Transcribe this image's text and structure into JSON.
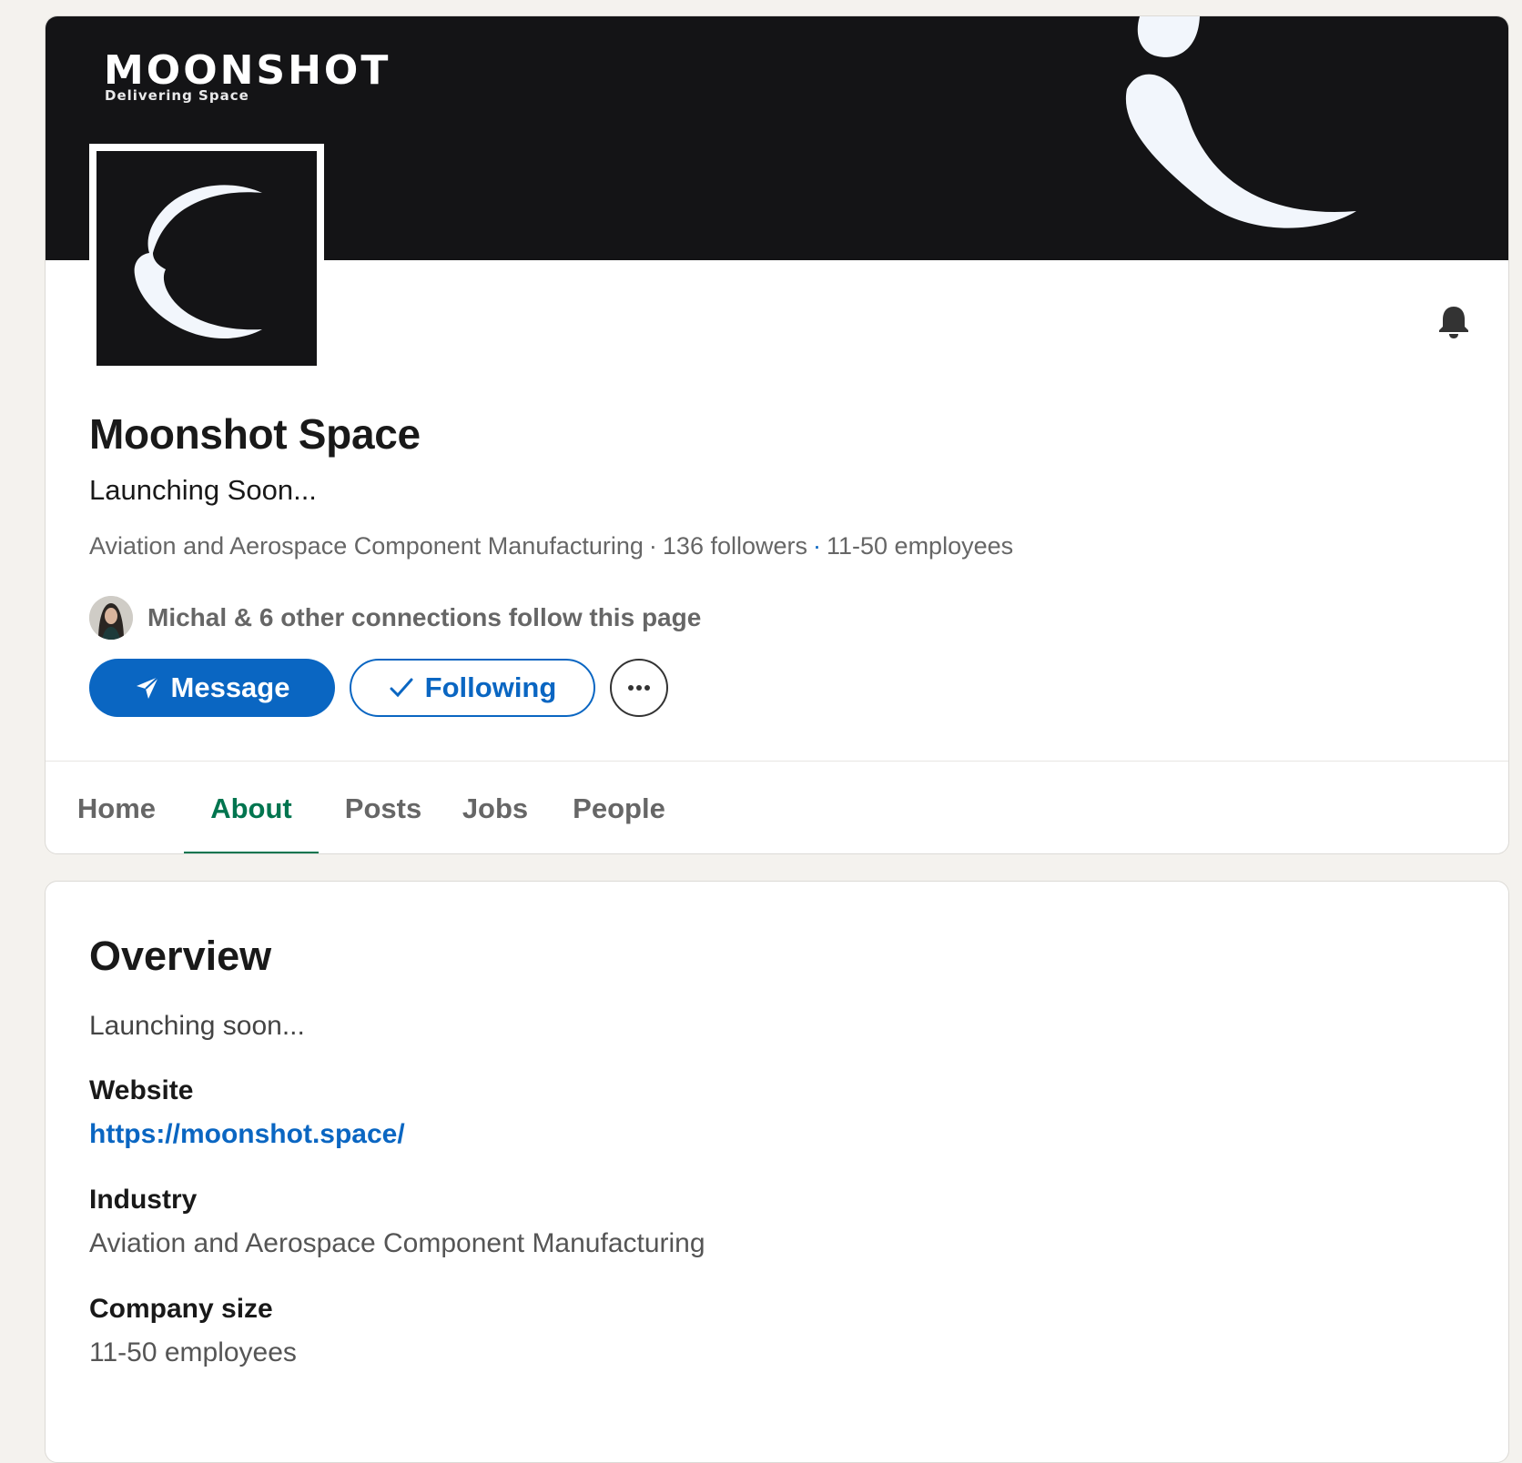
{
  "cover": {
    "wordmark": "MOONSHOT",
    "wordmark_tagline": "Delivering Space",
    "background_color": "#141416"
  },
  "company": {
    "name": "Moonshot Space",
    "tagline": "Launching Soon...",
    "industry": "Aviation and Aerospace Component Manufacturing",
    "followers": "136 followers",
    "size": "11-50 employees"
  },
  "connections": {
    "text": "Michal & 6 other connections follow this page"
  },
  "actions": {
    "message_label": "Message",
    "message_icon": "send-icon",
    "following_label": "Following",
    "following_icon": "checkmark-icon",
    "more_icon": "ellipsis-icon",
    "notification_icon": "bell-icon"
  },
  "tabs": [
    {
      "label": "Home",
      "active": false
    },
    {
      "label": "About",
      "active": true
    },
    {
      "label": "Posts",
      "active": false
    },
    {
      "label": "Jobs",
      "active": false
    },
    {
      "label": "People",
      "active": false
    }
  ],
  "overview": {
    "title": "Overview",
    "description": "Launching soon...",
    "website_label": "Website",
    "website_value": "https://moonshot.space/",
    "industry_label": "Industry",
    "industry_value": "Aviation and Aerospace Component Manufacturing",
    "size_label": "Company size",
    "size_value": "11-50 employees"
  },
  "colors": {
    "primary_blue": "#0a66c2",
    "active_tab_green": "#01754f",
    "page_background": "#f4f2ee"
  }
}
